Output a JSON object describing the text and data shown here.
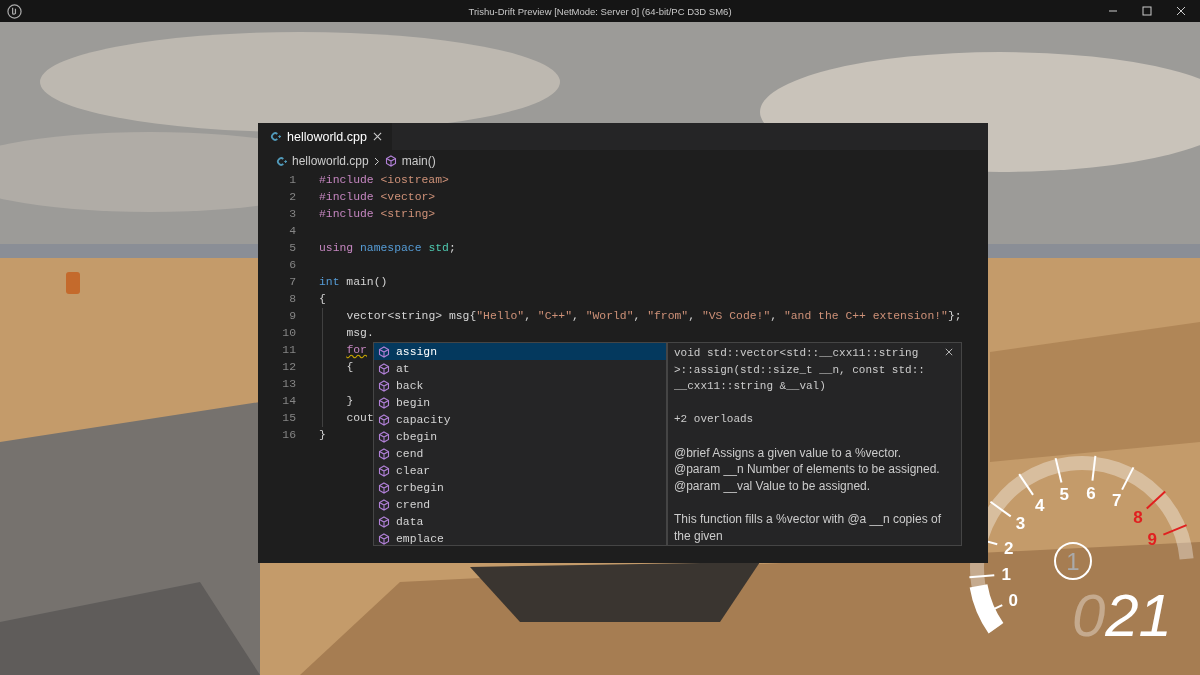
{
  "window": {
    "title": "Trishu-Drift Preview [NetMode: Server 0]  (64-bit/PC D3D SM6)"
  },
  "editor": {
    "tabs": [
      {
        "label": "helloworld.cpp",
        "selected": true
      }
    ],
    "breadcrumb": [
      "helloworld.cpp",
      "main()"
    ],
    "lines": [
      {
        "number": "1",
        "indented": false,
        "tokens": [
          {
            "text": "#include",
            "kind": "directive"
          },
          {
            "text": " <iostream>",
            "kind": "string"
          }
        ]
      },
      {
        "number": "2",
        "indented": false,
        "tokens": [
          {
            "text": "#include",
            "kind": "directive"
          },
          {
            "text": " <vector>",
            "kind": "string"
          }
        ]
      },
      {
        "number": "3",
        "indented": false,
        "tokens": [
          {
            "text": "#include",
            "kind": "directive"
          },
          {
            "text": " <string>",
            "kind": "string"
          }
        ]
      },
      {
        "number": "4",
        "indented": false
      },
      {
        "number": "5",
        "indented": false,
        "tokens": [
          {
            "text": "using",
            "kind": "control"
          },
          {
            "text": " namespace",
            "kind": "keyword"
          },
          {
            "text": " std",
            "kind": "type"
          },
          {
            "text": ";",
            "kind": "plain"
          }
        ]
      },
      {
        "number": "6",
        "indented": false
      },
      {
        "number": "7",
        "indented": false,
        "tokens": [
          {
            "text": "int",
            "kind": "keyword"
          },
          {
            "text": " main()",
            "kind": "plain"
          }
        ]
      },
      {
        "number": "8",
        "indented": false,
        "tokens": [
          {
            "text": "{",
            "kind": "plain"
          }
        ]
      },
      {
        "number": "9",
        "indented": true,
        "tokens": [
          {
            "text": "vector<string> msg{",
            "kind": "plain"
          },
          {
            "text": "\"Hello\"",
            "kind": "string"
          },
          {
            "text": ", ",
            "kind": "plain"
          },
          {
            "text": "\"C++\"",
            "kind": "string"
          },
          {
            "text": ", ",
            "kind": "plain"
          },
          {
            "text": "\"World\"",
            "kind": "string"
          },
          {
            "text": ", ",
            "kind": "plain"
          },
          {
            "text": "\"from\"",
            "kind": "string"
          },
          {
            "text": ", ",
            "kind": "plain"
          },
          {
            "text": "\"VS Code!\"",
            "kind": "string"
          },
          {
            "text": ", ",
            "kind": "plain"
          },
          {
            "text": "\"and the C++ extension!\"",
            "kind": "string"
          },
          {
            "text": "};",
            "kind": "plain"
          }
        ]
      },
      {
        "number": "10",
        "indented": true,
        "tokens": [
          {
            "text": "msg.",
            "kind": "plain"
          }
        ]
      },
      {
        "number": "11",
        "indented": true,
        "tokens": [
          {
            "text": "for",
            "kind": "control",
            "squiggle": true
          }
        ]
      },
      {
        "number": "12",
        "indented": true,
        "tokens": [
          {
            "text": "{",
            "kind": "plain"
          }
        ]
      },
      {
        "number": "13",
        "indented": true
      },
      {
        "number": "14",
        "indented": true,
        "tokens": [
          {
            "text": "}",
            "kind": "plain"
          }
        ]
      },
      {
        "number": "15",
        "indented": true,
        "tokens": [
          {
            "text": "cout",
            "kind": "plain"
          }
        ]
      },
      {
        "number": "16",
        "indented": false,
        "tokens": [
          {
            "text": "}",
            "kind": "plain"
          }
        ]
      }
    ],
    "suggestions": [
      {
        "label": "assign",
        "selected": true
      },
      {
        "label": "at",
        "selected": false
      },
      {
        "label": "back",
        "selected": false
      },
      {
        "label": "begin",
        "selected": false
      },
      {
        "label": "capacity",
        "selected": false
      },
      {
        "label": "cbegin",
        "selected": false
      },
      {
        "label": "cend",
        "selected": false
      },
      {
        "label": "clear",
        "selected": false
      },
      {
        "label": "crbegin",
        "selected": false
      },
      {
        "label": "crend",
        "selected": false
      },
      {
        "label": "data",
        "selected": false
      },
      {
        "label": "emplace",
        "selected": false
      }
    ],
    "details": {
      "signature": [
        "void std::vector<std::__cxx11::string",
        ">::assign(std::size_t __n, const std::",
        "__cxx11::string &__val)"
      ],
      "overloads": "+2 overloads",
      "params": [
        "@brief Assigns a given value to a %vector.",
        "@param __n Number of elements to be assigned.",
        "@param __val Value to be assigned."
      ],
      "body": [
        "This function fills a %vector with @a __n copies of",
        "the given"
      ]
    }
  },
  "hud": {
    "gear": "1",
    "speed": {
      "leading": "0",
      "value": "21"
    },
    "tach": {
      "level": 0.12,
      "lower_ticks": [
        {
          "label": "3",
          "redline": false
        },
        {
          "label": "2",
          "redline": false
        },
        {
          "label": "1",
          "redline": false
        },
        {
          "label": "0",
          "redline": false
        }
      ],
      "upper_ticks": [
        {
          "label": "4",
          "redline": false
        },
        {
          "label": "5",
          "redline": false
        },
        {
          "label": "6",
          "redline": false
        },
        {
          "label": "7",
          "redline": false
        },
        {
          "label": "8",
          "redline": true
        },
        {
          "label": "9",
          "redline": true
        }
      ]
    }
  }
}
